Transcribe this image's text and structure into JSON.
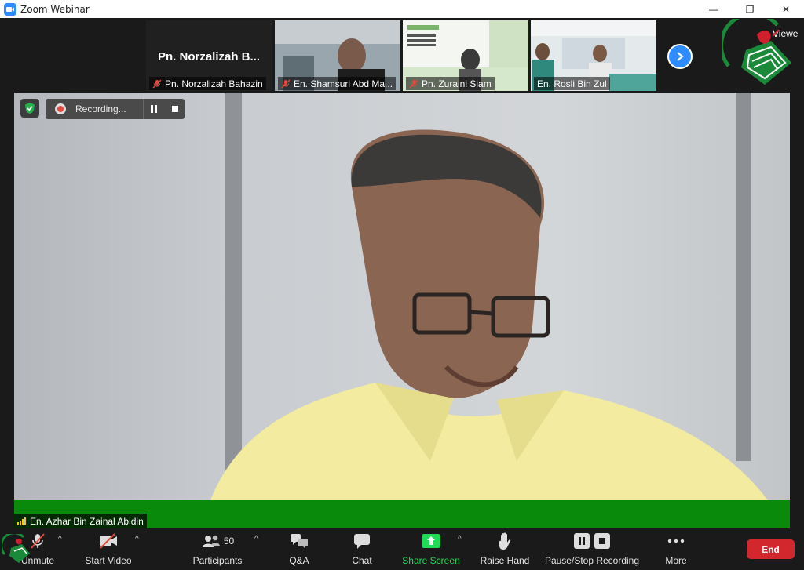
{
  "window": {
    "title": "Zoom Webinar",
    "minimize": "—",
    "restore": "❐",
    "close": "✕"
  },
  "thumbnails": [
    {
      "name": "Pn. Norzalizah Bahazin",
      "big_name": "Pn. Norzalizah B..."
    },
    {
      "name": "En. Shamsuri Abd Ma..."
    },
    {
      "name": "Pn. Zuraini Siam"
    },
    {
      "name": "En. Rosli Bin Zul"
    }
  ],
  "view_label": "Viewe",
  "recording": {
    "label": "Recording..."
  },
  "active_speaker": {
    "name": "En. Azhar Bin Zainal Abidin"
  },
  "toolbar": {
    "unmute": "Unmute",
    "start_video": "Start Video",
    "participants": "Participants",
    "participants_count": "50",
    "qa": "Q&A",
    "chat": "Chat",
    "share_screen": "Share Screen",
    "raise_hand": "Raise Hand",
    "pause_stop_recording": "Pause/Stop Recording",
    "more": "More",
    "end": "End"
  },
  "colors": {
    "zoom_blue": "#2d8cff",
    "speaker_green": "#0a8a0a",
    "share_green": "#23d959",
    "end_red": "#d3272e"
  }
}
